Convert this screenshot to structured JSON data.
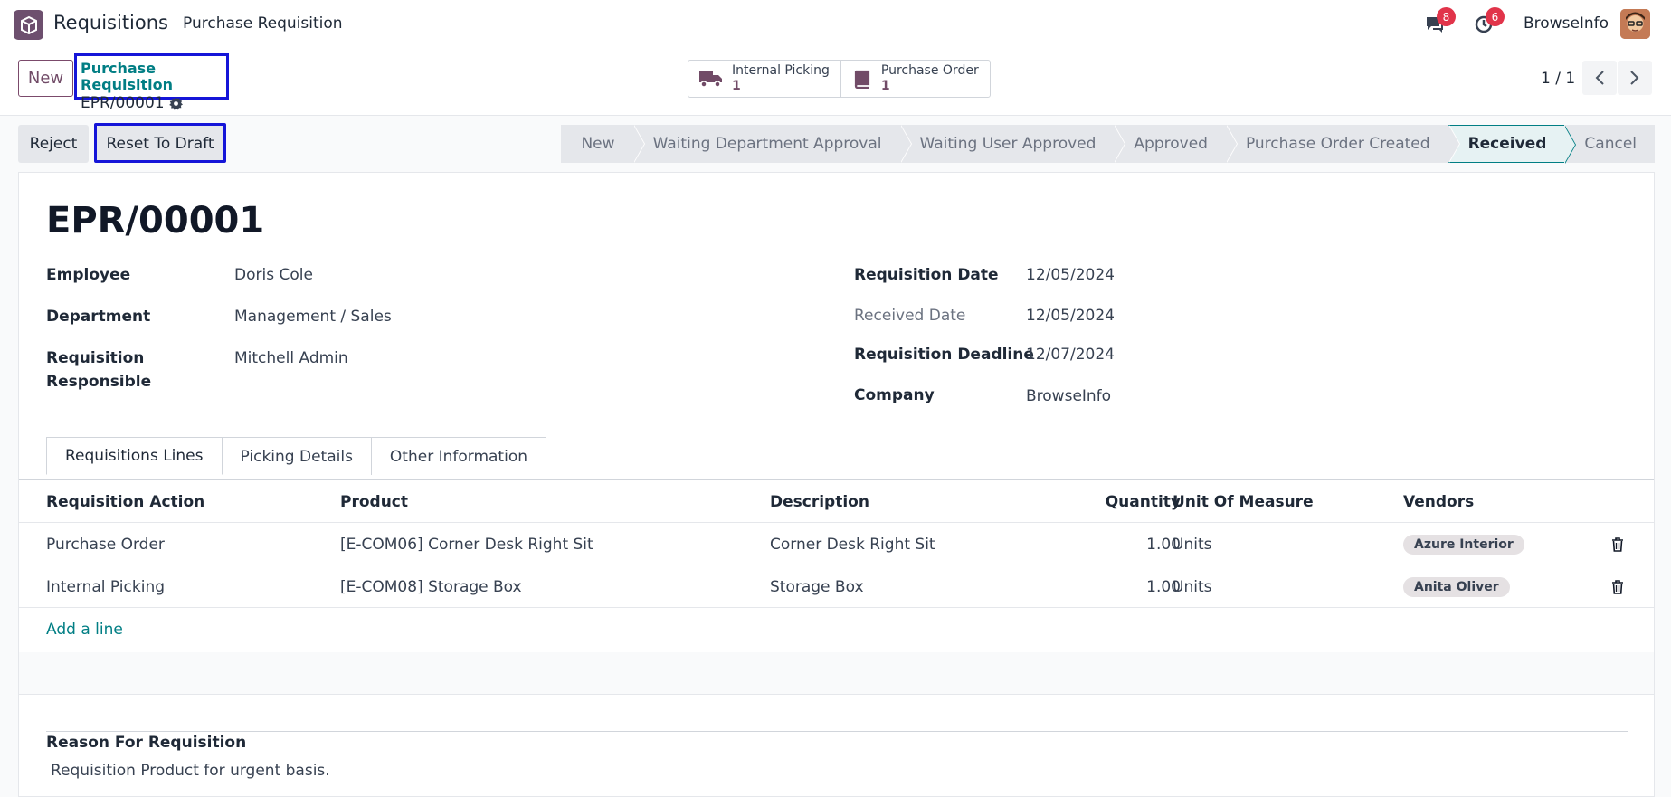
{
  "navbar": {
    "app_name": "Requisitions",
    "menu_item": "Purchase Requisition",
    "messages_count": "8",
    "activities_count": "6",
    "company": "BrowseInfo"
  },
  "control_panel": {
    "new_label": "New",
    "breadcrumb_parent": "Purchase Requisition",
    "breadcrumb_current": "EPR/00001",
    "smart_buttons": [
      {
        "label": "Internal Picking",
        "value": "1"
      },
      {
        "label": "Purchase Order",
        "value": "1"
      }
    ],
    "pager": "1 / 1"
  },
  "actions": {
    "reject": "Reject",
    "reset_to_draft": "Reset To Draft"
  },
  "statusbar": {
    "stages": [
      "New",
      "Waiting Department Approval",
      "Waiting User Approved",
      "Approved",
      "Purchase Order Created",
      "Received",
      "Cancel"
    ],
    "active": "Received"
  },
  "form": {
    "title": "EPR/00001",
    "employee_label": "Employee",
    "employee": "Doris Cole",
    "department_label": "Department",
    "department": "Management / Sales",
    "responsible_label_1": "Requisition",
    "responsible_label_2": "Responsible",
    "responsible": "Mitchell Admin",
    "requisition_date_label": "Requisition Date",
    "requisition_date": "12/05/2024",
    "received_date_label": "Received Date",
    "received_date": "12/05/2024",
    "deadline_label": "Requisition Deadline",
    "deadline": "12/07/2024",
    "company_label": "Company",
    "company": "BrowseInfo"
  },
  "tabs": [
    "Requisitions Lines",
    "Picking Details",
    "Other Information"
  ],
  "lines": {
    "headers": [
      "Requisition Action",
      "Product",
      "Description",
      "Quantity",
      "Unit Of Measure",
      "Vendors"
    ],
    "rows": [
      {
        "action": "Purchase Order",
        "product": "[E-COM06] Corner Desk Right Sit",
        "description": "Corner Desk Right Sit",
        "quantity": "1.00",
        "uom": "Units",
        "vendor": "Azure Interior"
      },
      {
        "action": "Internal Picking",
        "product": "[E-COM08] Storage Box",
        "description": "Storage Box",
        "quantity": "1.00",
        "uom": "Units",
        "vendor": "Anita Oliver"
      }
    ],
    "add_line": "Add a line"
  },
  "reason": {
    "label": "Reason For Requisition",
    "text": "Requisition Product for urgent basis."
  },
  "colors": {
    "brand": "#714b67",
    "accent": "#017e84",
    "highlight_box": "#1515d8",
    "badge": "#e1344a"
  }
}
